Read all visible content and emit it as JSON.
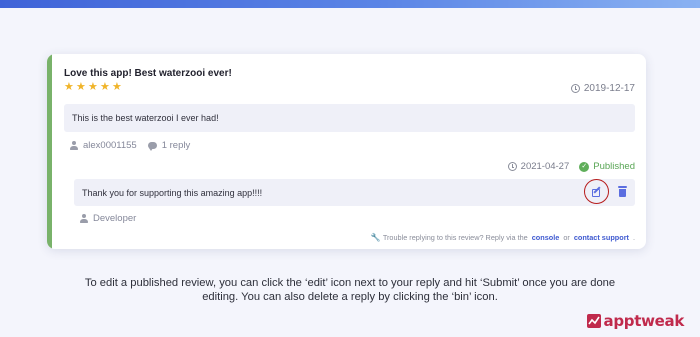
{
  "review": {
    "title": "Love this app! Best waterzooi ever!",
    "rating": 5,
    "date": "2019-12-17",
    "body": "This is the best waterzooi I ever had!",
    "author": "alex0001155",
    "replies_count": "1 reply"
  },
  "reply": {
    "date": "2021-04-27",
    "status": "Published",
    "text": "Thank you for supporting this amazing app!!!!",
    "author": "Developer"
  },
  "help": {
    "text_before": "Trouble replying to this review? Reply via the",
    "link_console": "console",
    "text_or": "or",
    "link_support": "contact support",
    "text_end": "."
  },
  "caption": {
    "line1": "To edit a published review, you can click the ‘edit’ icon next to your reply and hit ‘Submit’ once you are done",
    "line2": "editing. You can also delete a reply by clicking the ‘bin’ icon."
  },
  "brand": {
    "name": "apptweak",
    "color": "#c02a4c"
  },
  "colors": {
    "accent_green": "#79b26a",
    "published_green": "#5fae5a",
    "action_blue": "#5b6ee0",
    "highlight_red": "#b71c1c",
    "star_gold": "#f0b429"
  },
  "icons": {
    "date": "clock-icon",
    "author": "user-icon",
    "replies": "chat-bubble-icon",
    "status": "check-circle-icon",
    "edit": "edit-icon",
    "delete": "bin-icon",
    "help": "wrench-icon"
  }
}
